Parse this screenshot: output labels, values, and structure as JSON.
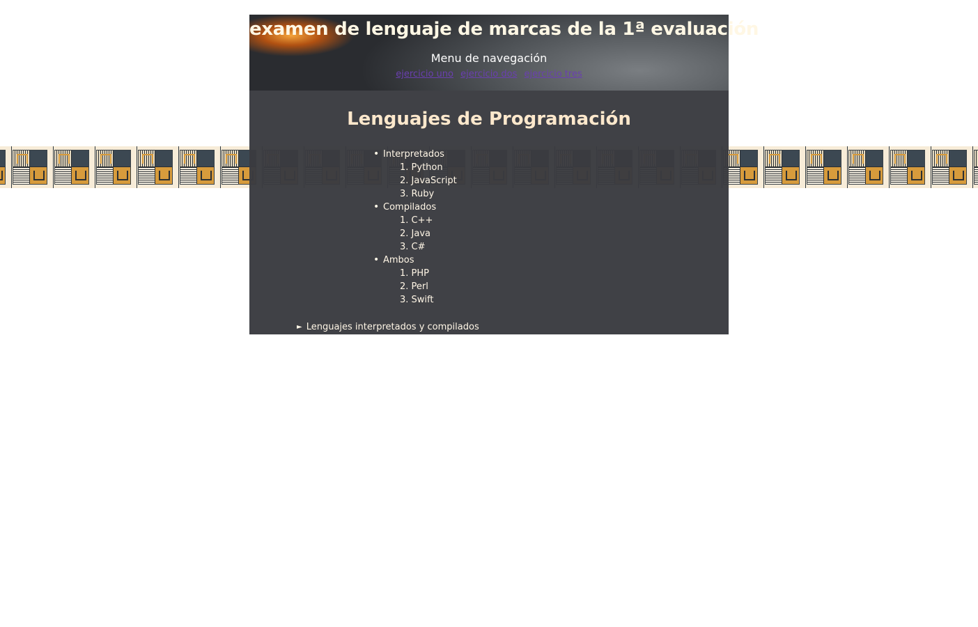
{
  "header": {
    "title": "examen de lenguaje de marcas de la 1ª evaluación",
    "nav_title": "Menu de navegación",
    "nav_links": [
      {
        "label": "ejercicio uno"
      },
      {
        "label": "ejercicio dos"
      },
      {
        "label": "ejercicio tres"
      }
    ],
    "link_color": "#6a3fb0"
  },
  "main": {
    "heading": "Lenguajes de Programación",
    "groups": [
      {
        "label": "Interpretados",
        "items": [
          "1. Python",
          "2. JavaScript",
          "3. Ruby"
        ]
      },
      {
        "label": "Compilados",
        "items": [
          "1. C++",
          "2. Java",
          "3. C#"
        ]
      },
      {
        "label": "Ambos",
        "items": [
          "1. PHP",
          "2. Perl",
          "3. Swift"
        ]
      }
    ],
    "details_summary": "Lenguajes interpretados y compilados",
    "details_icon": "triangle-right-icon"
  },
  "colors": {
    "content_background": "#3a3b40",
    "heading_text": "#fde8cc",
    "body_text": "#fff6e6",
    "pattern_accent": "#d79b3c",
    "pattern_dark": "#3c4852"
  }
}
